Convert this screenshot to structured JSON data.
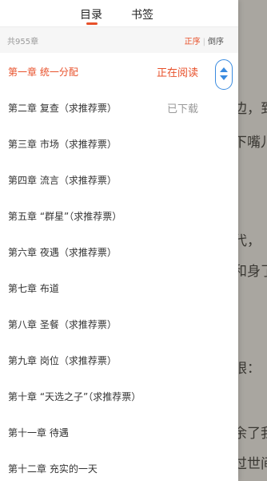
{
  "tabs": {
    "toc": "目录",
    "bookmarks": "书签"
  },
  "header": {
    "count": "共955章",
    "sort_asc": "正序",
    "sort_sep": "|",
    "sort_desc": "倒序"
  },
  "chapters": [
    {
      "title": "第一章 统一分配",
      "status": "正在阅读"
    },
    {
      "title": "第二章 复查（求推荐票）",
      "status": "已下载"
    },
    {
      "title": "第三章 市场（求推荐票）",
      "status": ""
    },
    {
      "title": "第四章 流言（求推荐票）",
      "status": ""
    },
    {
      "title": "第五章 “群星”（求推荐票）",
      "status": ""
    },
    {
      "title": "第六章 夜遇（求推荐票）",
      "status": ""
    },
    {
      "title": "第七章 布道",
      "status": ""
    },
    {
      "title": "第八章 圣餐（求推荐票）",
      "status": ""
    },
    {
      "title": "第九章 岗位（求推荐票）",
      "status": ""
    },
    {
      "title": "第十章 “天选之子”（求推荐票）",
      "status": ""
    },
    {
      "title": "第十一章 待遇",
      "status": ""
    },
    {
      "title": "第十二章 充实的一天",
      "status": ""
    }
  ],
  "reader_text": [
    "边，到",
    "下嘴儿",
    "代，",
    "和身了",
    "眼：",
    "余了我",
    "过世间"
  ],
  "colors": {
    "accent": "#e8512b",
    "scroll_handle": "#3a8be0"
  },
  "icons": {
    "scroll_handle": "up-down-arrows-icon"
  }
}
